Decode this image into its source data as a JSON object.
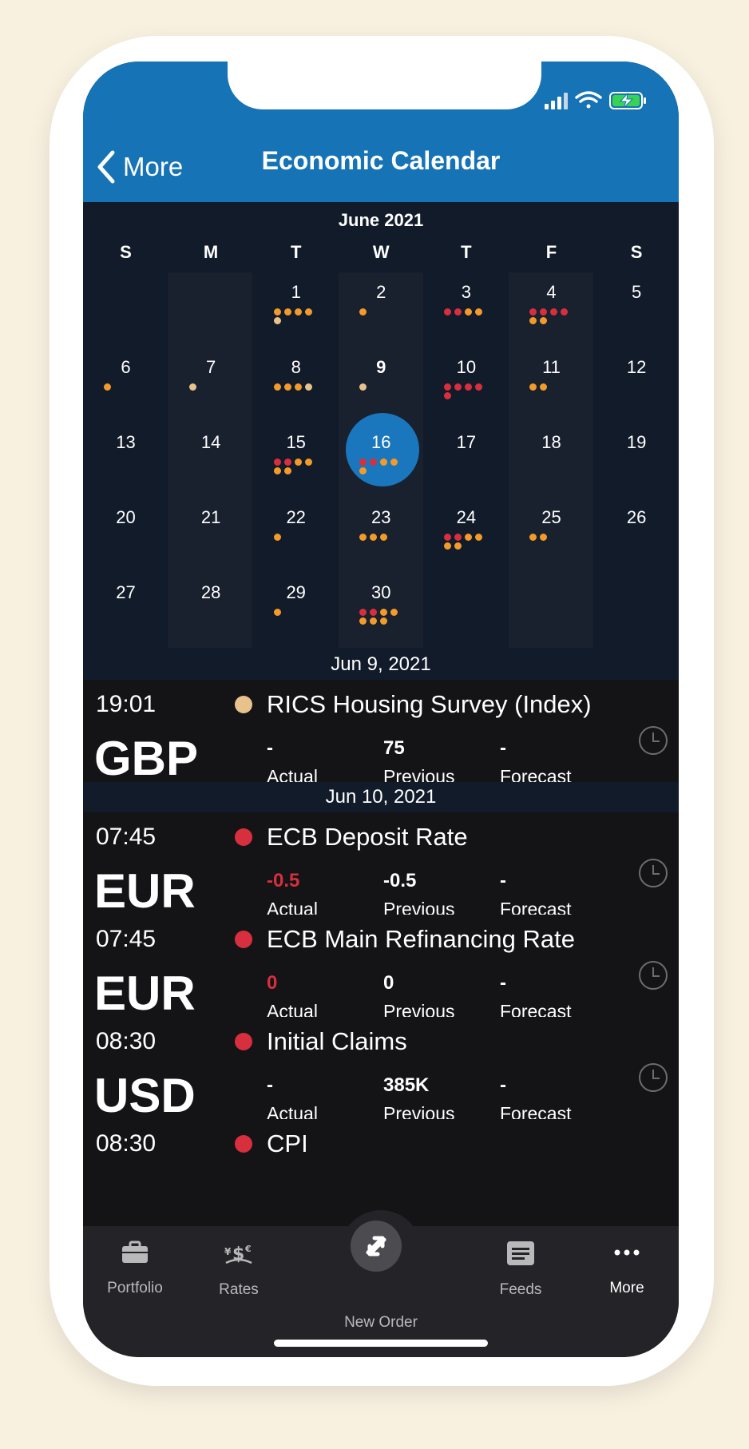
{
  "nav": {
    "back_label": "More",
    "title": "Economic Calendar"
  },
  "calendar": {
    "month_label": "June 2021",
    "weekdays": [
      "S",
      "M",
      "T",
      "W",
      "T",
      "F",
      "S"
    ],
    "selected_day": "9",
    "days": [
      {
        "n": "1",
        "dots": [
          "#f29b2b",
          "#f29b2b",
          "#f29b2b",
          "#f29b2b",
          "#e8c28c"
        ]
      },
      {
        "n": "2",
        "dots": [
          "#f29b2b"
        ]
      },
      {
        "n": "3",
        "dots": [
          "#d72f3e",
          "#d72f3e",
          "#f29b2b",
          "#f29b2b"
        ]
      },
      {
        "n": "4",
        "dots": [
          "#d72f3e",
          "#d72f3e",
          "#d72f3e",
          "#d72f3e",
          "#f29b2b",
          "#f29b2b"
        ]
      },
      {
        "n": "5",
        "dots": []
      },
      {
        "n": "6",
        "dots": [
          "#f29b2b"
        ]
      },
      {
        "n": "7",
        "dots": [
          "#e8c28c"
        ]
      },
      {
        "n": "8",
        "dots": [
          "#f29b2b",
          "#f29b2b",
          "#f29b2b",
          "#e8c28c"
        ]
      },
      {
        "n": "9",
        "dots": [
          "#e8c28c"
        ]
      },
      {
        "n": "10",
        "dots": [
          "#d72f3e",
          "#d72f3e",
          "#d72f3e",
          "#d72f3e",
          "#d72f3e"
        ]
      },
      {
        "n": "11",
        "dots": [
          "#f29b2b",
          "#f29b2b"
        ]
      },
      {
        "n": "12",
        "dots": []
      },
      {
        "n": "13",
        "dots": []
      },
      {
        "n": "14",
        "dots": []
      },
      {
        "n": "15",
        "dots": [
          "#d72f3e",
          "#d72f3e",
          "#f29b2b",
          "#f29b2b",
          "#f29b2b",
          "#f29b2b"
        ]
      },
      {
        "n": "16",
        "dots": [
          "#d72f3e",
          "#d72f3e",
          "#f29b2b",
          "#f29b2b",
          "#f29b2b"
        ]
      },
      {
        "n": "17",
        "dots": []
      },
      {
        "n": "18",
        "dots": []
      },
      {
        "n": "19",
        "dots": []
      },
      {
        "n": "20",
        "dots": []
      },
      {
        "n": "21",
        "dots": []
      },
      {
        "n": "22",
        "dots": [
          "#f29b2b"
        ]
      },
      {
        "n": "23",
        "dots": [
          "#f29b2b",
          "#f29b2b",
          "#f29b2b"
        ]
      },
      {
        "n": "24",
        "dots": [
          "#d72f3e",
          "#d72f3e",
          "#f29b2b",
          "#f29b2b",
          "#f29b2b",
          "#f29b2b"
        ]
      },
      {
        "n": "25",
        "dots": [
          "#f29b2b",
          "#f29b2b"
        ]
      },
      {
        "n": "26",
        "dots": []
      },
      {
        "n": "27",
        "dots": []
      },
      {
        "n": "28",
        "dots": []
      },
      {
        "n": "29",
        "dots": [
          "#f29b2b"
        ]
      },
      {
        "n": "30",
        "dots": [
          "#d72f3e",
          "#d72f3e",
          "#f29b2b",
          "#f29b2b",
          "#f29b2b",
          "#f29b2b",
          "#f29b2b"
        ]
      }
    ]
  },
  "sections": [
    {
      "date": "Jun 9, 2021",
      "events": [
        {
          "time": "19:01",
          "name": "RICS Housing Survey (Index)",
          "currency": "GBP",
          "impact_color": "#e8c28c",
          "actual": "-",
          "actual_color": "#ffffff",
          "previous": "75",
          "forecast": "-"
        }
      ]
    },
    {
      "date": "Jun 10, 2021",
      "events": [
        {
          "time": "07:45",
          "name": "ECB Deposit Rate",
          "currency": "EUR",
          "impact_color": "#d72f3e",
          "actual": "-0.5",
          "actual_color": "#d72f3e",
          "previous": "-0.5",
          "forecast": "-"
        },
        {
          "time": "07:45",
          "name": "ECB Main Refinancing Rate",
          "currency": "EUR",
          "impact_color": "#d72f3e",
          "actual": "0",
          "actual_color": "#d72f3e",
          "previous": "0",
          "forecast": "-"
        },
        {
          "time": "08:30",
          "name": "Initial Claims",
          "currency": "USD",
          "impact_color": "#d72f3e",
          "actual": "-",
          "actual_color": "#ffffff",
          "previous": "385K",
          "forecast": "-"
        },
        {
          "time": "08:30",
          "name": "CPI",
          "currency": "",
          "impact_color": "#d72f3e",
          "actual": "",
          "actual_color": "#ffffff",
          "previous": "",
          "forecast": ""
        }
      ]
    }
  ],
  "labels": {
    "actual": "Actual",
    "previous": "Previous",
    "forecast": "Forecast"
  },
  "tabbar": {
    "portfolio": "Portfolio",
    "rates": "Rates",
    "new_order": "New Order",
    "feeds": "Feeds",
    "more": "More"
  },
  "colors": {
    "header": "#1673b5",
    "calendar_bg": "#121b2a",
    "selected": "#1a77bd",
    "high_impact": "#d72f3e",
    "medium_impact": "#f29b2b",
    "low_impact": "#e8c28c"
  }
}
